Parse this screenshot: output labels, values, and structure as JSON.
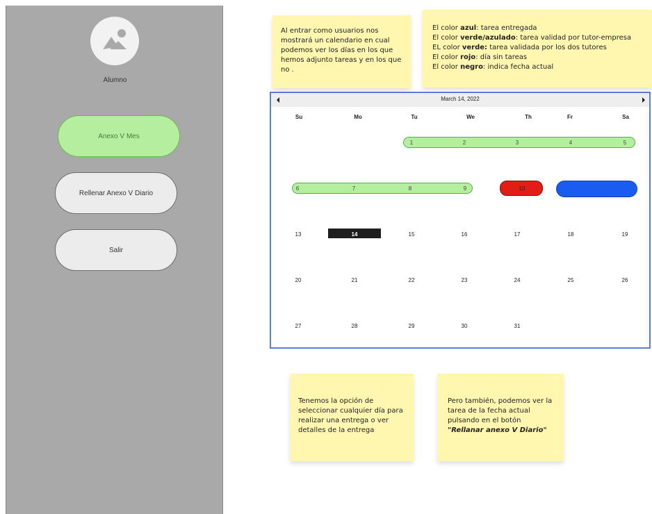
{
  "sidebar": {
    "avatar_label": "Alumno",
    "buttons": [
      {
        "label": "Anexo V Mes"
      },
      {
        "label": "Rellenar Anexo V Diario"
      },
      {
        "label": "Salir"
      }
    ]
  },
  "notes": {
    "note1": "Al entrar como usuarios nos mostrará  un calendario en cual podemos ver los días en los que hemos adjunto tareas y en los que no .",
    "legend": [
      {
        "prefix": "El color ",
        "bold": "azul",
        "rest": ": tarea entregada"
      },
      {
        "prefix": "El color ",
        "bold": "verde/azulado",
        "rest": ": tarea validad por tutor-empresa"
      },
      {
        "prefix": "EL color ",
        "bold": "verde:",
        "rest": " tarea validada por los dos tutores"
      },
      {
        "prefix": "El color ",
        "bold": "rojo",
        "rest": ": día sin tareas"
      },
      {
        "prefix": "El color ",
        "bold": "negro",
        "rest": ": indica fecha actual"
      }
    ],
    "note3": "Tenemos la opción de seleccionar cualquier día para realizar una entrega o ver detalles de la entrega",
    "note4_text": "Pero también, podemos ver la tarea de la fecha actual pulsando en el botón",
    "note4_italic": "\"Rellanar anexo V Diario\""
  },
  "calendar": {
    "title": "March 14, 2022",
    "weekdays": [
      "Su",
      "Mo",
      "Tu",
      "We",
      "Th",
      "Fr",
      "Sa"
    ],
    "week1": [
      "1",
      "2",
      "3",
      "4",
      "5"
    ],
    "week2": [
      "6",
      "7",
      "8",
      "9",
      "10"
    ],
    "week3": [
      "13",
      "14",
      "15",
      "16",
      "17",
      "18",
      "19"
    ],
    "week4": [
      "20",
      "21",
      "22",
      "23",
      "24",
      "25",
      "26"
    ],
    "week5": [
      "27",
      "28",
      "29",
      "30",
      "31"
    ],
    "colors": {
      "green": "#b4ee9e",
      "red": "#e11d15",
      "blue": "#1a5cf0",
      "today": "#1e1e1e",
      "border": "#5a7ed6"
    }
  }
}
